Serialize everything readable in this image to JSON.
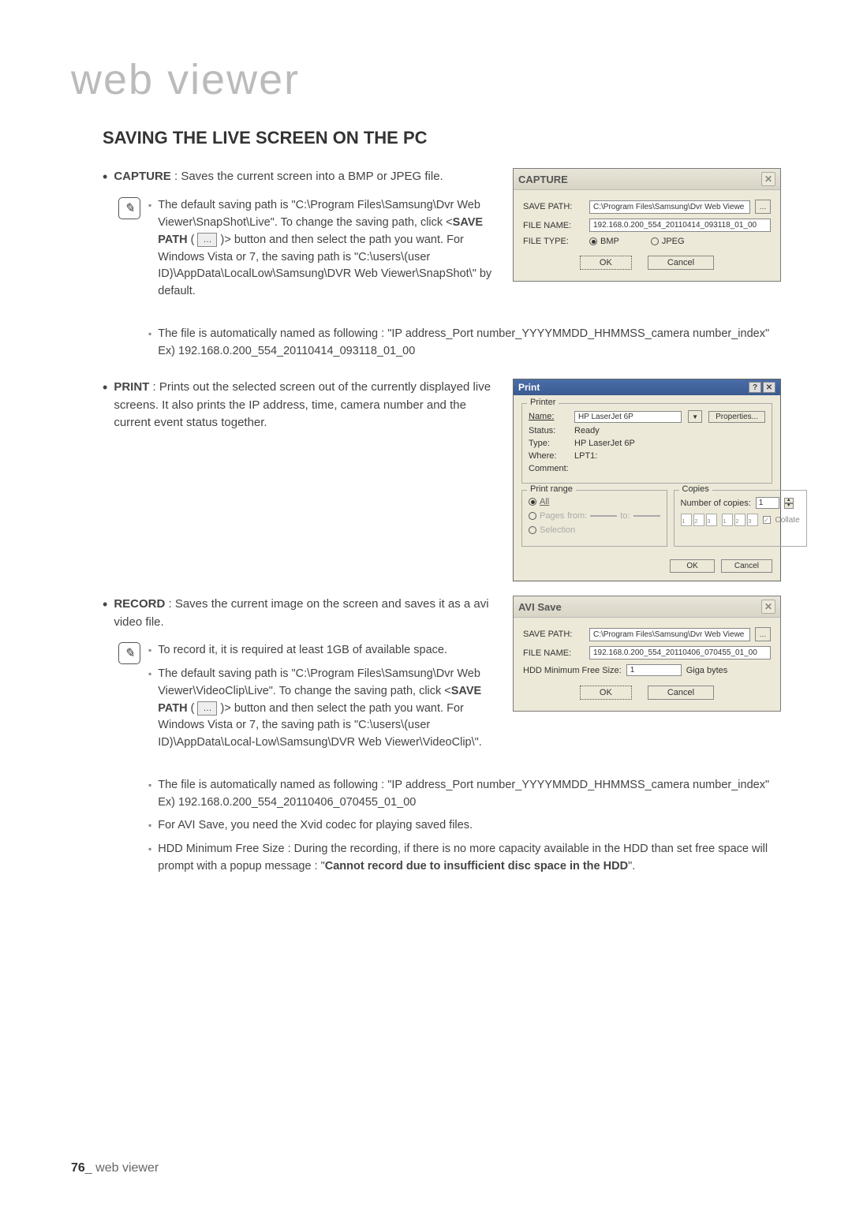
{
  "page": {
    "title": "web viewer",
    "footer_num": "76",
    "footer_text": "_ web viewer"
  },
  "section": {
    "heading": "SAVING THE LIVE SCREEN ON THE PC"
  },
  "capture": {
    "term": "CAPTURE",
    "desc": " : Saves the current screen into a BMP or JPEG file.",
    "note1a": "The default saving path is \"C:\\Program Files\\Samsung\\Dvr Web Viewer\\SnapShot\\Live\". To change the saving path, click <",
    "note1a_bold": "SAVE PATH",
    "note1a_mid": " ( ",
    "note1a_btn": "…",
    "note1a_tail": " )> button and then select the path you want. For Windows Vista or 7, the saving path is \"C:\\users\\(user ID)\\AppData\\LocalLow\\Samsung\\DVR Web Viewer\\SnapShot\\\" by default.",
    "note2": "The file is automatically named as following : \"IP address_Port number_YYYYMMDD_HHMMSS_camera number_index\"",
    "note2_ex": "Ex) 192.168.0.200_554_20110414_093118_01_00"
  },
  "capture_dialog": {
    "title": "CAPTURE",
    "save_path_lbl": "SAVE PATH:",
    "save_path_val": "C:\\Program Files\\Samsung\\Dvr Web Viewe",
    "file_name_lbl": "FILE NAME:",
    "file_name_val": "192.168.0.200_554_20110414_093118_01_00",
    "file_type_lbl": "FILE TYPE:",
    "radio_bmp": "BMP",
    "radio_jpeg": "JPEG",
    "ok": "OK",
    "cancel": "Cancel"
  },
  "print": {
    "term": "PRINT",
    "desc": " : Prints out the selected screen out of the currently displayed live screens. It also prints the IP address, time, camera number and the current event status together."
  },
  "print_dialog": {
    "title": "Print",
    "printer_legend": "Printer",
    "name_lbl": "Name:",
    "name_val": "HP LaserJet 6P",
    "properties": "Properties...",
    "status_lbl": "Status:",
    "status_val": "Ready",
    "type_lbl": "Type:",
    "type_val": "HP LaserJet 6P",
    "where_lbl": "Where:",
    "where_val": "LPT1:",
    "comment_lbl": "Comment:",
    "range_legend": "Print range",
    "range_all": "All",
    "range_pages": "Pages",
    "range_from": "from:",
    "range_to": "to:",
    "range_sel": "Selection",
    "copies_legend": "Copies",
    "copies_lbl": "Number of copies:",
    "copies_val": "1",
    "collate": "Collate",
    "ok": "OK",
    "cancel": "Cancel"
  },
  "record": {
    "term": "RECORD",
    "desc": " : Saves the current image on the screen and saves it as a avi video file.",
    "note1": "To record it, it is required at least 1GB of available space.",
    "note2a": "The default saving path is \"C:\\Program Files\\Samsung\\Dvr Web Viewer\\VideoClip\\Live\". To change the saving path, click <",
    "note2a_bold": "SAVE PATH",
    "note2a_mid": " ( ",
    "note2a_btn": "…",
    "note2a_tail": " )> button and then select the path you want. For Windows Vista or 7, the saving path is \"C:\\users\\(user ID)\\AppData\\Local-Low\\Samsung\\DVR Web Viewer\\VideoClip\\\".",
    "note3": "The file is automatically named as following : \"IP address_Port number_YYYYMMDD_HHMMSS_camera number_index\"",
    "note3_ex": "Ex) 192.168.0.200_554_20110406_070455_01_00",
    "note4": "For AVI Save, you need the Xvid codec for playing saved files.",
    "note5a": "HDD Minimum Free Size : During the recording, if there is no more capacity available in the HDD than set free space will prompt with a popup message : \"",
    "note5b": "Cannot record due to insufficient disc space in the HDD",
    "note5c": "\"."
  },
  "avi_dialog": {
    "title": "AVI Save",
    "save_path_lbl": "SAVE PATH:",
    "save_path_val": "C:\\Program Files\\Samsung\\Dvr Web Viewe",
    "file_name_lbl": "FILE NAME:",
    "file_name_val": "192.168.0.200_554_20110406_070455_01_00",
    "hdd_lbl": "HDD Minimum Free Size:",
    "hdd_val": "1",
    "hdd_unit": "Giga bytes",
    "ok": "OK",
    "cancel": "Cancel"
  }
}
